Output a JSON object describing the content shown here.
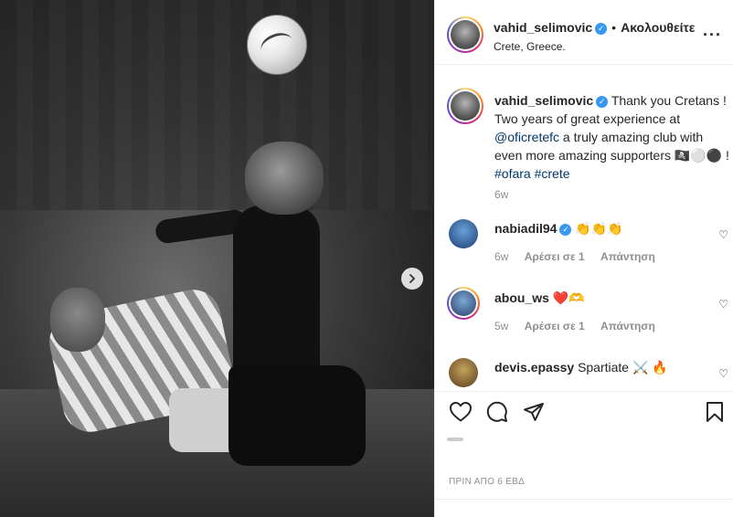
{
  "post": {
    "author": "vahid_selimovic",
    "follow_status": "Ακολουθείτε",
    "location": "Crete, Greece.",
    "caption_user": "vahid_selimovic",
    "caption_text": "Thank you Cretans ! Two years of great experience at",
    "caption_mention": "@oficretefc",
    "caption_text2": "a truly amazing club with even more amazing supporters 🏴‍☠️⚪⚫ !",
    "caption_tag1": "#ofara",
    "caption_tag2": "#crete",
    "caption_time": "6w",
    "timestamp": "ΠΡΙΝ ΑΠΟ 6 ΕΒΔ"
  },
  "comments": [
    {
      "user": "nabiadil94",
      "verified": true,
      "text": "👏👏👏",
      "time": "6w",
      "likes": "Αρέσει σε 1",
      "reply": "Απάντηση"
    },
    {
      "user": "abou_ws",
      "verified": false,
      "text": "❤️🫶",
      "time": "5w",
      "likes": "Αρέσει σε 1",
      "reply": "Απάντηση"
    },
    {
      "user": "devis.epassy",
      "verified": false,
      "text": "Spartiate ⚔️ 🔥"
    }
  ],
  "icons": {
    "more": "more-options-icon",
    "like": "heart-icon",
    "comment": "comment-icon",
    "share": "share-icon",
    "save": "bookmark-icon",
    "next": "chevron-right-icon"
  }
}
